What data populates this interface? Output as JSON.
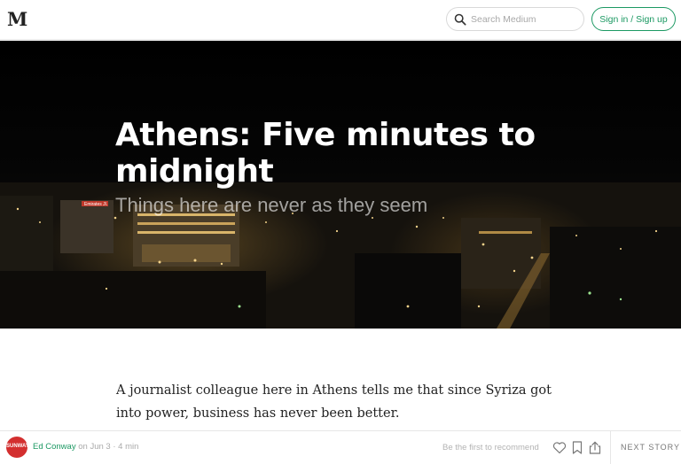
{
  "header": {
    "logo_text": "M",
    "search_placeholder": "Search Medium",
    "signin_label": "Sign in / Sign up"
  },
  "hero": {
    "title": "Athens: Five minutes to midnight",
    "subtitle": "Things here are never as they seem",
    "sign_text": "Emirates Jl."
  },
  "article": {
    "paragraph": "A journalist colleague here in Athens tells me that since Syriza got into power, business has never been better."
  },
  "footer": {
    "avatar_text": "SUNWAY",
    "author": "Ed Conway",
    "date": "on Jun 3",
    "separator": "·",
    "read_time": "4 min",
    "recommend_text": "Be the first to recommend",
    "next_story_label": "NEXT STORY",
    "icons": [
      "heart-icon",
      "bookmark-icon",
      "share-icon"
    ]
  },
  "colors": {
    "accent_green": "#1c9963",
    "avatar_red": "#d32f2f"
  }
}
